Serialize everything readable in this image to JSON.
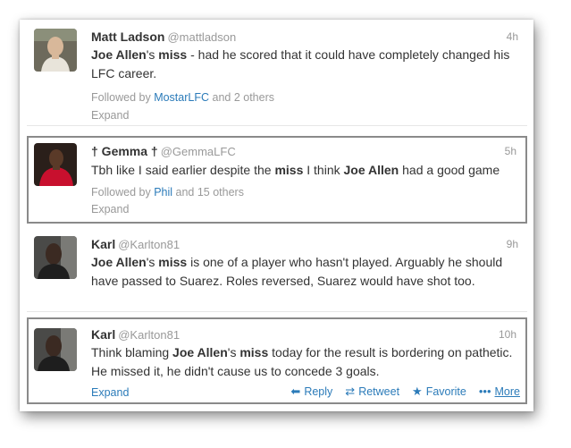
{
  "tweets": [
    {
      "name": "Matt Ladson",
      "handle": "@mattladson",
      "time": "4h",
      "text_parts": [
        "Joe Allen",
        "'s ",
        "miss",
        " - had he scored that it could have completely changed his LFC career."
      ],
      "followed_prefix": "Followed by ",
      "followed_link": "MostarLFC",
      "followed_suffix": " and 2 others",
      "expand": "Expand"
    },
    {
      "name": "† Gemma †",
      "handle": "@GemmaLFC",
      "time": "5h",
      "text_parts": [
        "Tbh like I said earlier despite the ",
        "miss",
        " I think ",
        "Joe Allen",
        " had a good game"
      ],
      "followed_prefix": "Followed by ",
      "followed_link": "Phil",
      "followed_suffix": " and 15 others",
      "expand": "Expand"
    },
    {
      "name": "Karl",
      "handle": "@Karlton81",
      "time": "9h",
      "text_parts": [
        "Joe Allen",
        "'s ",
        "miss",
        " is one of a player who hasn't played. Arguably he should have passed to Suarez. Roles reversed, Suarez would have shot too."
      ]
    },
    {
      "name": "Karl",
      "handle": "@Karlton81",
      "time": "10h",
      "text_parts": [
        "Think blaming ",
        "Joe Allen",
        "'s ",
        "miss",
        " today for the result is bordering on pathetic. He missed it, he didn't cause us to concede 3 goals."
      ],
      "expand": "Expand",
      "actions": {
        "reply": "Reply",
        "retweet": "Retweet",
        "favorite": "Favorite",
        "more": "More"
      }
    }
  ],
  "colors": {
    "link": "#2b7bb9",
    "meta": "#999999",
    "text": "#333333",
    "highlight_border": "#8a8a8a"
  },
  "icons": [
    "reply-icon",
    "retweet-icon",
    "favorite-icon",
    "more-icon"
  ]
}
